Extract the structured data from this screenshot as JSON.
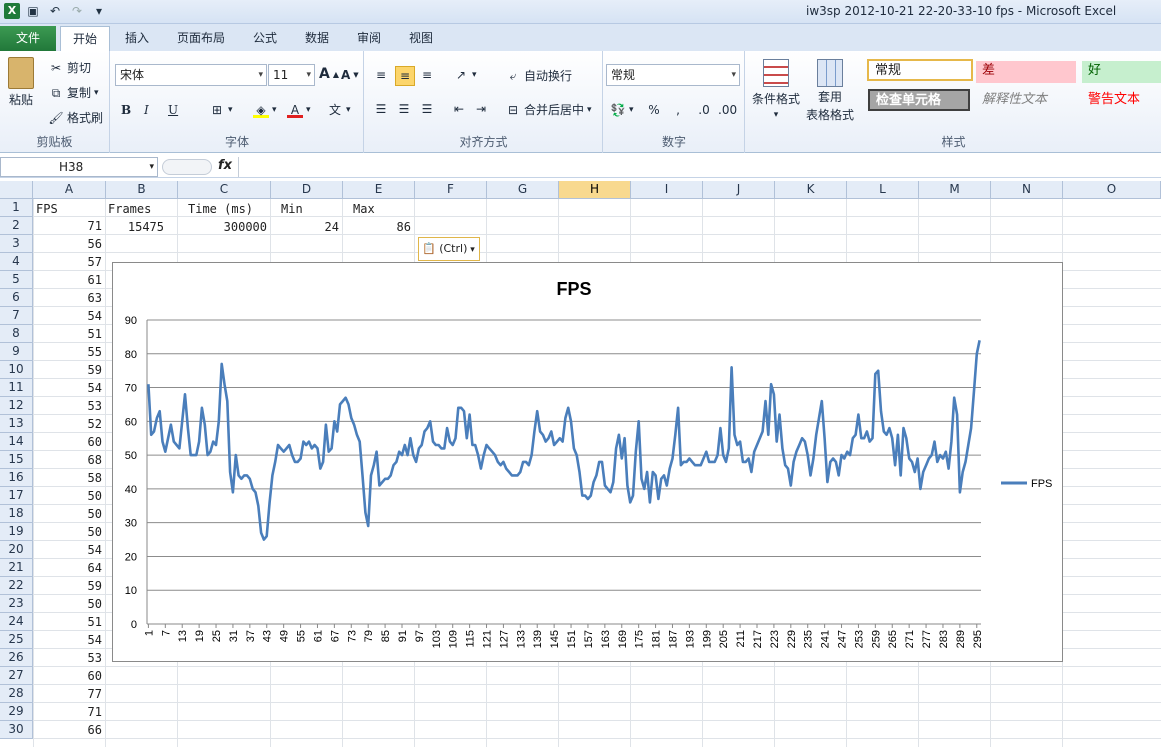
{
  "window": {
    "title": "iw3sp 2012-10-21 22-20-33-10 fps  -  Microsoft Excel",
    "app_icon": "excel-icon"
  },
  "quick_access": [
    {
      "name": "save-icon",
      "glyph": "💾"
    },
    {
      "name": "undo-icon",
      "glyph": "↶"
    },
    {
      "name": "redo-icon",
      "glyph": "↷"
    },
    {
      "name": "customize-icon",
      "glyph": "▾"
    }
  ],
  "tabs": [
    "文件",
    "开始",
    "插入",
    "页面布局",
    "公式",
    "数据",
    "审阅",
    "视图"
  ],
  "ribbon": {
    "clipboard": {
      "label": "剪贴板",
      "paste": "粘贴",
      "cut": "剪切",
      "copy": "复制",
      "format_painter": "格式刷"
    },
    "font": {
      "label": "字体",
      "name": "宋体",
      "size": "11",
      "bold": "B",
      "italic": "I",
      "underline": "U"
    },
    "alignment": {
      "label": "对齐方式",
      "wrap": "自动换行",
      "merge": "合并后居中"
    },
    "number": {
      "label": "数字",
      "format": "常规"
    },
    "styles": {
      "label": "样式",
      "conditional": "条件格式",
      "table_format_1": "套用",
      "table_format_2": "表格格式",
      "normal": "常规",
      "bad": "差",
      "good": "好",
      "check_cell": "检查单元格",
      "explanatory": "解释性文本",
      "warning": "警告文本"
    }
  },
  "formula_bar": {
    "name_box": "H38",
    "fx": "fx",
    "content": ""
  },
  "columns": [
    "A",
    "B",
    "C",
    "D",
    "E",
    "F",
    "G",
    "H",
    "I",
    "J",
    "K",
    "L",
    "M",
    "N",
    "O"
  ],
  "selected_column": "H",
  "rows": [
    "1",
    "2",
    "3",
    "4",
    "5",
    "6",
    "7",
    "8",
    "9",
    "10",
    "11",
    "12",
    "13",
    "14",
    "15",
    "16",
    "17",
    "18",
    "19",
    "20",
    "21",
    "22",
    "23",
    "24",
    "25",
    "26",
    "27",
    "28",
    "29",
    "30"
  ],
  "cells": {
    "A1": "FPS",
    "B1": "Frames",
    "C1": "Time (ms)",
    "D1": "Min",
    "E1": "Max",
    "B2": "15475",
    "C2": "300000",
    "D2": "24",
    "E2": "86",
    "colA": [
      "71",
      "56",
      "57",
      "61",
      "63",
      "54",
      "51",
      "55",
      "59",
      "54",
      "53",
      "52",
      "60",
      "68",
      "58",
      "50",
      "50",
      "50",
      "54",
      "64",
      "59",
      "50",
      "51",
      "54",
      "53",
      "60",
      "77",
      "71",
      "66"
    ]
  },
  "paste_options": "(Ctrl)",
  "chart_data": {
    "type": "line",
    "title": "FPS",
    "ylim": [
      0,
      90
    ],
    "yticks": [
      0,
      10,
      20,
      30,
      40,
      50,
      60,
      70,
      80,
      90
    ],
    "xticks": [
      "1",
      "7",
      "13",
      "19",
      "25",
      "31",
      "37",
      "43",
      "49",
      "55",
      "61",
      "67",
      "73",
      "79",
      "85",
      "91",
      "97",
      "103",
      "109",
      "115",
      "121",
      "127",
      "133",
      "139",
      "145",
      "151",
      "157",
      "163",
      "169",
      "175",
      "181",
      "187",
      "193",
      "199",
      "205",
      "211",
      "217",
      "223",
      "229",
      "235",
      "241",
      "247",
      "253",
      "259",
      "265",
      "271",
      "277",
      "283",
      "289",
      "295"
    ],
    "series": [
      {
        "name": "FPS",
        "color": "#4a7ebb",
        "values": [
          71,
          56,
          57,
          61,
          63,
          54,
          51,
          55,
          59,
          54,
          53,
          52,
          60,
          68,
          58,
          50,
          50,
          50,
          54,
          64,
          59,
          50,
          51,
          54,
          53,
          60,
          77,
          71,
          66,
          45,
          39,
          50,
          44,
          43,
          44,
          44,
          43,
          40,
          39,
          35,
          27,
          25,
          26,
          36,
          44,
          48,
          53,
          52,
          51,
          52,
          53,
          50,
          48,
          48,
          49,
          54,
          53,
          54,
          52,
          53,
          52,
          46,
          48,
          59,
          51,
          52,
          60,
          57,
          65,
          66,
          67,
          65,
          61,
          59,
          56,
          54,
          44,
          33,
          29,
          44,
          47,
          51,
          41,
          42,
          43,
          43,
          44,
          47,
          48,
          51,
          50,
          53,
          50,
          55,
          50,
          48,
          52,
          53,
          57,
          58,
          60,
          54,
          53,
          53,
          52,
          52,
          58,
          54,
          53,
          55,
          64,
          64,
          63,
          55,
          62,
          53,
          53,
          50,
          46,
          50,
          53,
          52,
          51,
          50,
          48,
          47,
          48,
          46,
          45,
          44,
          44,
          44,
          45,
          48,
          48,
          47,
          50,
          57,
          63,
          57,
          56,
          54,
          55,
          57,
          53,
          54,
          55,
          54,
          61,
          64,
          60,
          52,
          50,
          45,
          38,
          38,
          37,
          38,
          42,
          44,
          48,
          48,
          41,
          40,
          39,
          42,
          52,
          56,
          49,
          55,
          41,
          36,
          38,
          51,
          60,
          43,
          40,
          45,
          36,
          45,
          44,
          37,
          43,
          44,
          41,
          46,
          49,
          56,
          64,
          47,
          48,
          48,
          49,
          48,
          47,
          47,
          47,
          49,
          51,
          48,
          48,
          48,
          50,
          58,
          50,
          48,
          52,
          76,
          56,
          53,
          54,
          48,
          48,
          49,
          45,
          51,
          53,
          55,
          57,
          66,
          56,
          71,
          68,
          54,
          62,
          52,
          47,
          46,
          41,
          48,
          51,
          53,
          55,
          54,
          50,
          44,
          49,
          56,
          61,
          66,
          55,
          42,
          48,
          49,
          48,
          44,
          50,
          49,
          51,
          50,
          55,
          56,
          62,
          55,
          55,
          57,
          54,
          55,
          74,
          75,
          63,
          57,
          56,
          58,
          55,
          47,
          56,
          44,
          58,
          55,
          49,
          48,
          45,
          49,
          40,
          45,
          47,
          49,
          50,
          54,
          48,
          50,
          49,
          51,
          46,
          54,
          67,
          62,
          39,
          45,
          48,
          53,
          58,
          69,
          80,
          84
        ]
      }
    ],
    "legend": "right"
  }
}
